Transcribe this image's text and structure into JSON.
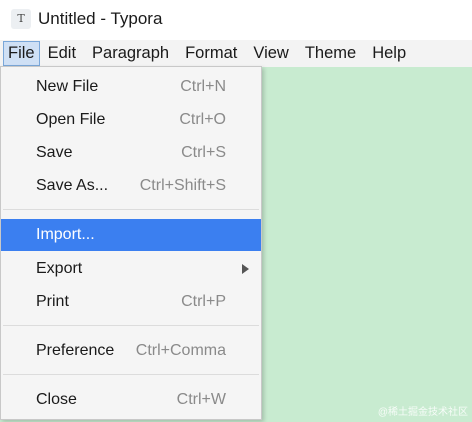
{
  "window": {
    "icon_letter": "T",
    "title": "Untitled - Typora"
  },
  "menubar": {
    "items": [
      {
        "label": "File",
        "active": true
      },
      {
        "label": "Edit"
      },
      {
        "label": "Paragraph"
      },
      {
        "label": "Format"
      },
      {
        "label": "View"
      },
      {
        "label": "Theme"
      },
      {
        "label": "Help"
      }
    ]
  },
  "file_menu": {
    "items": [
      {
        "label": "New File",
        "shortcut": "Ctrl+N"
      },
      {
        "label": "Open File",
        "shortcut": "Ctrl+O"
      },
      {
        "label": "Save",
        "shortcut": "Ctrl+S"
      },
      {
        "label": "Save As...",
        "shortcut": "Ctrl+Shift+S"
      },
      {
        "label": "Import...",
        "shortcut": "",
        "highlighted": true
      },
      {
        "label": "Export",
        "shortcut": "",
        "submenu": true
      },
      {
        "label": "Print",
        "shortcut": "Ctrl+P"
      },
      {
        "label": "Preference",
        "shortcut": "Ctrl+Comma"
      },
      {
        "label": "Close",
        "shortcut": "Ctrl+W"
      }
    ]
  },
  "editor": {
    "background_color": "#c8ebd0",
    "watermark": "@稀土掘金技术社区"
  },
  "colors": {
    "highlight": "#3b7ff0",
    "menubar_active_bg": "#cfe0f5",
    "menubar_active_border": "#7aa7d9"
  }
}
